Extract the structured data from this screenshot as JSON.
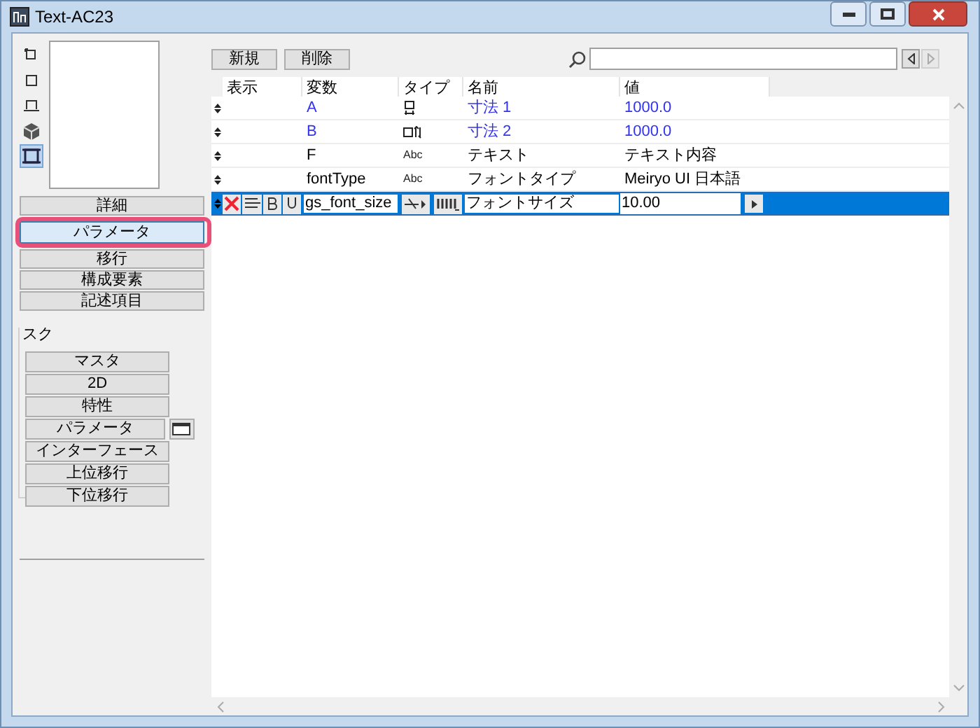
{
  "window": {
    "title": "Text-AC23"
  },
  "view_icons": [
    {
      "kind": "plan",
      "selected": false
    },
    {
      "kind": "square",
      "selected": false
    },
    {
      "kind": "elevation",
      "selected": false
    },
    {
      "kind": "cube",
      "selected": false
    },
    {
      "kind": "section",
      "selected": true
    }
  ],
  "pages": [
    {
      "label": "詳細",
      "selected": false
    },
    {
      "label": "パラメータ",
      "selected": true
    },
    {
      "label": "移行",
      "selected": false
    },
    {
      "label": "構成要素",
      "selected": false
    },
    {
      "label": "記述項目",
      "selected": false
    }
  ],
  "script_group": {
    "title": "スク",
    "items": [
      {
        "label": "マスタ",
        "window_button": false
      },
      {
        "label": "2D",
        "window_button": false
      },
      {
        "label": "特性",
        "window_button": false
      },
      {
        "label": "パラメータ",
        "window_button": true
      },
      {
        "label": "インターフェース",
        "window_button": false
      },
      {
        "label": "上位移行",
        "window_button": false
      },
      {
        "label": "下位移行",
        "window_button": false
      }
    ]
  },
  "toolbar": {
    "buttons": [
      "新規",
      "削除"
    ]
  },
  "table": {
    "columns": [
      "表示",
      "変数",
      "タイプ",
      "名前",
      "値"
    ],
    "rows": [
      {
        "variable": "A",
        "type": {
          "kind": "length_vertical"
        },
        "name": "寸法 1",
        "value": "1000.0",
        "linked": true,
        "selected": false
      },
      {
        "variable": "B",
        "type": {
          "kind": "length_horizontal"
        },
        "name": "寸法 2",
        "value": "1000.0",
        "linked": true,
        "selected": false
      },
      {
        "variable": "F",
        "type": {
          "kind": "text",
          "label": "Abc"
        },
        "name": "テキスト",
        "value": "テキスト内容",
        "linked": false,
        "selected": false
      },
      {
        "variable": "fontType",
        "type": {
          "kind": "text",
          "label": "Abc"
        },
        "name": "フォントタイプ",
        "value": "Meiryo UI 日本語",
        "linked": false,
        "selected": false
      },
      {
        "variable": "gs_font_size",
        "type": {
          "kind": "font_size"
        },
        "name": "フォントサイズ",
        "value": "10.00",
        "linked": false,
        "selected": true
      }
    ]
  }
}
